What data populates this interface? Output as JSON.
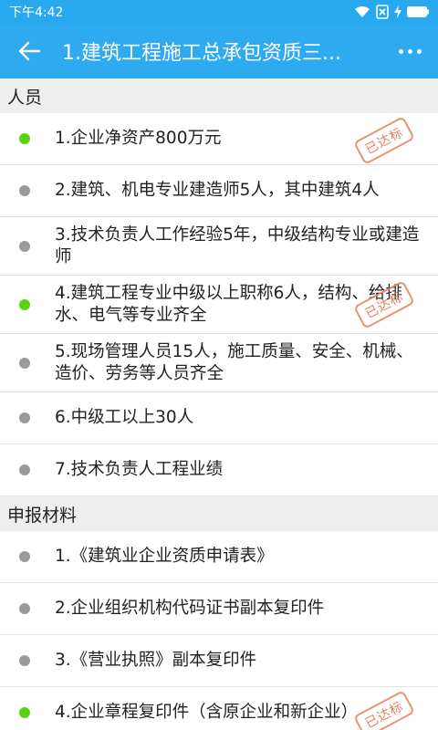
{
  "status_bar": {
    "time": "下午4:42"
  },
  "app_bar": {
    "title": "1.建筑工程施工总承包资质三..."
  },
  "sections": [
    {
      "title": "人员",
      "items": [
        {
          "text": "1.企业净资产800万元",
          "status": "green",
          "stamp": "已达标"
        },
        {
          "text": "2.建筑、机电专业建造师5人，其中建筑4人",
          "status": "grey"
        },
        {
          "text": "3.技术负责人工作经验5年，中级结构专业或建造师",
          "status": "grey"
        },
        {
          "text": "4.建筑工程专业中级以上职称6人，结构、给排水、电气等专业齐全",
          "status": "green",
          "stamp": "已达标"
        },
        {
          "text": "5.现场管理人员15人，施工质量、安全、机械、造价、劳务等人员齐全",
          "status": "grey"
        },
        {
          "text": "6.中级工以上30人",
          "status": "grey"
        },
        {
          "text": "7.技术负责人工程业绩",
          "status": "grey"
        }
      ]
    },
    {
      "title": "申报材料",
      "items": [
        {
          "text": "1.《建筑业企业资质申请表》",
          "status": "grey"
        },
        {
          "text": "2.企业组织机构代码证书副本复印件",
          "status": "grey"
        },
        {
          "text": "3.《营业执照》副本复印件",
          "status": "grey"
        },
        {
          "text": "4.企业章程复印件（含原企业和新企业）",
          "status": "green",
          "stamp": "已达标"
        }
      ]
    }
  ],
  "colors": {
    "primary": "#2eaaf0",
    "achieved": "#5ad214",
    "pending": "#9a9a9a",
    "stamp": "#e06a45"
  }
}
